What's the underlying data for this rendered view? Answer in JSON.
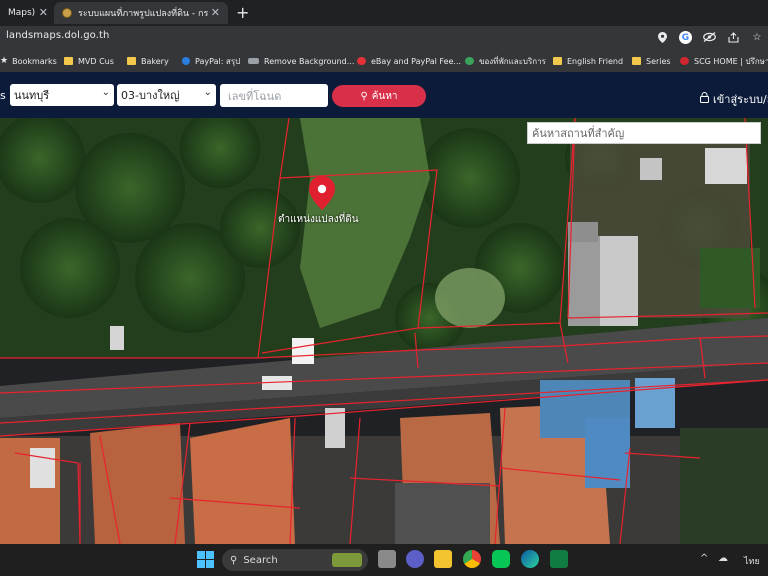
{
  "browser": {
    "tabs": [
      {
        "title": "Maps)",
        "active": false
      },
      {
        "title": "ระบบแผนที่ภาพรูปแปลงที่ดิน - กรมที่ดิน",
        "active": true
      }
    ],
    "url": "landsmaps.dol.go.th",
    "bookmarks": [
      {
        "label": "Bookmarks",
        "icon": "star-icon"
      },
      {
        "label": "MVD Cus",
        "icon": "folder-icon"
      },
      {
        "label": "Bakery",
        "icon": "folder-icon"
      },
      {
        "label": "PayPal: สรุป",
        "icon": "paypal-icon"
      },
      {
        "label": "Remove Background...",
        "icon": "remove-bg-icon"
      },
      {
        "label": "eBay and PayPal Fee...",
        "icon": "ebay-icon"
      },
      {
        "label": "ของที่พักและบริการ",
        "icon": "shield-icon"
      },
      {
        "label": "English Friend",
        "icon": "folder-icon"
      },
      {
        "label": "Series",
        "icon": "folder-icon"
      },
      {
        "label": "SCG HOME | ปรึกษา",
        "icon": "scg-icon"
      }
    ]
  },
  "site": {
    "province": "นนทบุรี",
    "amphoe": "03-บางใหญ่",
    "deed_placeholder": "เลขที่โฉนด",
    "search_label": "ค้นหา",
    "login_label": "เข้าสู่ระบบ/ล",
    "left_cut_label": "s",
    "place_search_placeholder": "ค้นหาสถานที่สำคัญ",
    "pin_label": "ตำแหน่งแปลงที่ดิน"
  },
  "taskbar": {
    "search_label": "Search",
    "tray_lang": "ไทย"
  },
  "colors": {
    "header_bg": "#0c1b3a",
    "search_button": "#d9304a",
    "parcel_lines": "#e8232e",
    "pin": "#e0202e"
  }
}
